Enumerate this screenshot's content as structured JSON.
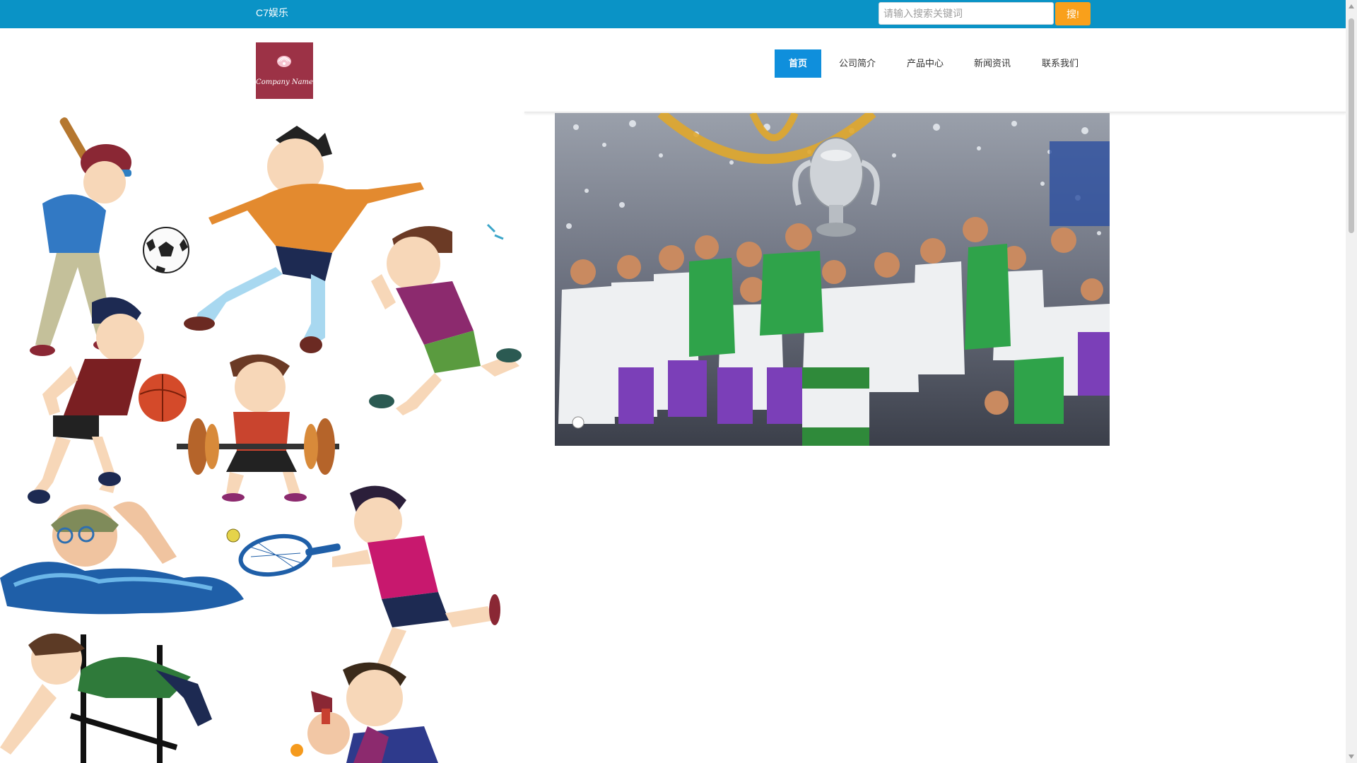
{
  "header": {
    "site_title": "C7娱乐",
    "search": {
      "placeholder": "请输入搜索关键词",
      "value": "",
      "button_label": "搜!"
    }
  },
  "logo": {
    "text": "Company Name",
    "icon": "shell-icon"
  },
  "nav": {
    "items": [
      {
        "label": "首页",
        "active": true
      },
      {
        "label": "公司简介",
        "active": false
      },
      {
        "label": "产品中心",
        "active": false
      },
      {
        "label": "新闻资讯",
        "active": false
      },
      {
        "label": "联系我们",
        "active": false
      }
    ]
  },
  "colors": {
    "topbar": "#0a93c6",
    "search_button": "#f9a01b",
    "nav_active": "#0f8fdc",
    "logo_bg": "#9c3246"
  }
}
